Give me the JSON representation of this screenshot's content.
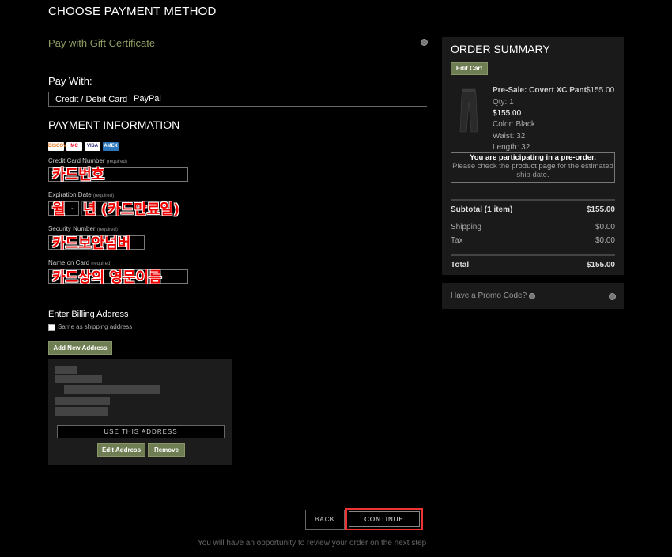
{
  "header": {
    "title": "CHOOSE PAYMENT METHOD"
  },
  "gift": {
    "label": "Pay with Gift Certificate"
  },
  "pay_with": {
    "label": "Pay With:",
    "tabs": [
      {
        "label": "Credit / Debit Card"
      },
      {
        "label": "PayPal"
      }
    ]
  },
  "payment": {
    "title": "PAYMENT INFORMATION",
    "card_logos": [
      {
        "name": "DISCOVER",
        "bg": "#ffffff",
        "fg": "#e87a1c"
      },
      {
        "name": "MC",
        "bg": "#ffffff",
        "fg": "#eb001b"
      },
      {
        "name": "VISA",
        "bg": "#ffffff",
        "fg": "#1a1f71"
      },
      {
        "name": "AMEX",
        "bg": "#2e77bb",
        "fg": "#ffffff"
      }
    ],
    "required": "(required)",
    "card_number_label": "Credit Card Number",
    "card_number_overlay": "카드번호",
    "expiration_label": "Expiration Date",
    "month_overlay": "월",
    "year_overlay": "년 (카드만료일)",
    "security_label": "Security Number",
    "security_overlay": "카드보안넘버",
    "name_label": "Name on Card",
    "name_overlay": "카드상의 영문이름"
  },
  "billing": {
    "title": "Enter Billing Address",
    "same_as_shipping": "Same as shipping address",
    "add_new": "Add New Address",
    "use_this": "USE THIS ADDRESS",
    "edit": "Edit Address",
    "remove": "Remove"
  },
  "nav": {
    "back": "BACK",
    "continue": "CONTINUE",
    "note": "You will have an opportunity to review your order on the next step"
  },
  "summary": {
    "title": "ORDER SUMMARY",
    "edit_cart": "Edit Cart",
    "product": {
      "name": "Pre-Sale: Covert XC Pant",
      "price": "$155.00",
      "qty": "Qty: 1",
      "unit_price": "$155.00",
      "color": "Color: Black",
      "waist": "Waist: 32",
      "length": "Length: 32"
    },
    "preorder_bold": "You are participating in a pre-order.",
    "preorder_pre": "Please check the ",
    "preorder_link": "product page",
    "preorder_post": " for the estimated ship date.",
    "rows": [
      {
        "label": "Subtotal (1 item)",
        "value": "$155.00"
      },
      {
        "label": "Shipping",
        "value": "$0.00"
      },
      {
        "label": "Tax",
        "value": "$0.00"
      },
      {
        "label": "Total",
        "value": "$155.00"
      }
    ]
  },
  "promo": {
    "label": "Have a Promo Code?"
  }
}
